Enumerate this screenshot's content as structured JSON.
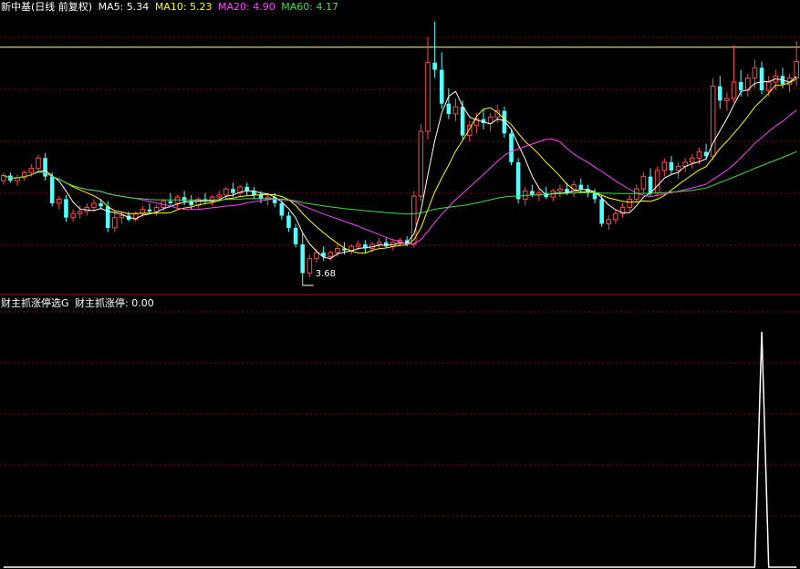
{
  "main_legend": {
    "name": "新中基(日线 前复权)",
    "ma5": "MA5: 5.34",
    "ma10": "MA10: 5.23",
    "ma20": "MA20: 4.90",
    "ma60": "MA60: 4.17"
  },
  "sub_legend": {
    "name": "财主抓涨停选G",
    "value": "财主抓涨停: 0.00"
  },
  "colors": {
    "background": "#000000",
    "grid": "#8b0000",
    "up": "#ff4a4a",
    "down": "#54ffff",
    "ma5": "#ffffff",
    "ma10": "#ffff00",
    "ma20": "#ff44ff",
    "ma60": "#44dd44",
    "hline": "#ffff88",
    "signal": "#ffffff"
  },
  "chart_data": [
    {
      "type": "candlestick",
      "title": "新中基(日线 前复权)",
      "y_range": [
        3.6,
        6.3
      ],
      "horizontal_line": 6.0,
      "low_marker": "3.68",
      "ohlc": [
        [
          4.7,
          4.78,
          4.66,
          4.75
        ],
        [
          4.75,
          4.78,
          4.68,
          4.7
        ],
        [
          4.7,
          4.76,
          4.65,
          4.73
        ],
        [
          4.73,
          4.8,
          4.7,
          4.78
        ],
        [
          4.78,
          4.86,
          4.74,
          4.82
        ],
        [
          4.82,
          4.95,
          4.8,
          4.92
        ],
        [
          4.92,
          4.97,
          4.7,
          4.74
        ],
        [
          4.74,
          4.78,
          4.45,
          4.48
        ],
        [
          4.48,
          4.55,
          4.42,
          4.52
        ],
        [
          4.52,
          4.56,
          4.3,
          4.34
        ],
        [
          4.34,
          4.42,
          4.3,
          4.38
        ],
        [
          4.38,
          4.46,
          4.33,
          4.4
        ],
        [
          4.4,
          4.48,
          4.36,
          4.44
        ],
        [
          4.44,
          4.52,
          4.4,
          4.48
        ],
        [
          4.48,
          4.52,
          4.42,
          4.45
        ],
        [
          4.45,
          4.5,
          4.2,
          4.24
        ],
        [
          4.24,
          4.4,
          4.2,
          4.34
        ],
        [
          4.34,
          4.4,
          4.28,
          4.36
        ],
        [
          4.36,
          4.4,
          4.3,
          4.32
        ],
        [
          4.32,
          4.4,
          4.3,
          4.38
        ],
        [
          4.38,
          4.45,
          4.35,
          4.42
        ],
        [
          4.42,
          4.48,
          4.38,
          4.4
        ],
        [
          4.4,
          4.46,
          4.36,
          4.44
        ],
        [
          4.44,
          4.52,
          4.4,
          4.5
        ],
        [
          4.5,
          4.58,
          4.46,
          4.48
        ],
        [
          4.48,
          4.56,
          4.44,
          4.54
        ],
        [
          4.54,
          4.6,
          4.46,
          4.5
        ],
        [
          4.5,
          4.56,
          4.42,
          4.46
        ],
        [
          4.46,
          4.54,
          4.42,
          4.52
        ],
        [
          4.52,
          4.58,
          4.48,
          4.5
        ],
        [
          4.5,
          4.56,
          4.46,
          4.54
        ],
        [
          4.54,
          4.6,
          4.5,
          4.56
        ],
        [
          4.56,
          4.64,
          4.52,
          4.62
        ],
        [
          4.62,
          4.68,
          4.54,
          4.58
        ],
        [
          4.58,
          4.66,
          4.54,
          4.64
        ],
        [
          4.64,
          4.68,
          4.56,
          4.6
        ],
        [
          4.6,
          4.64,
          4.52,
          4.56
        ],
        [
          4.56,
          4.6,
          4.48,
          4.52
        ],
        [
          4.52,
          4.58,
          4.46,
          4.54
        ],
        [
          4.54,
          4.58,
          4.44,
          4.48
        ],
        [
          4.48,
          4.52,
          4.32,
          4.36
        ],
        [
          4.36,
          4.4,
          4.2,
          4.24
        ],
        [
          4.24,
          4.28,
          4.05,
          4.08
        ],
        [
          4.08,
          4.18,
          3.68,
          3.8
        ],
        [
          3.8,
          3.98,
          3.76,
          3.94
        ],
        [
          3.94,
          4.04,
          3.9,
          4.0
        ],
        [
          4.0,
          4.06,
          3.92,
          3.96
        ],
        [
          3.96,
          4.02,
          3.92,
          4.0
        ],
        [
          4.0,
          4.08,
          3.96,
          4.04
        ],
        [
          4.04,
          4.1,
          3.98,
          4.02
        ],
        [
          4.02,
          4.08,
          3.98,
          4.06
        ],
        [
          4.06,
          4.12,
          4.02,
          4.08
        ],
        [
          4.08,
          4.12,
          4.0,
          4.04
        ],
        [
          4.04,
          4.1,
          4.0,
          4.08
        ],
        [
          4.08,
          4.14,
          4.04,
          4.1
        ],
        [
          4.1,
          4.14,
          4.04,
          4.06
        ],
        [
          4.06,
          4.12,
          4.02,
          4.1
        ],
        [
          4.1,
          4.14,
          4.06,
          4.12
        ],
        [
          4.12,
          4.16,
          4.06,
          4.08
        ],
        [
          4.08,
          4.6,
          4.05,
          4.55
        ],
        [
          4.55,
          5.25,
          4.5,
          5.18
        ],
        [
          5.18,
          6.1,
          5.1,
          5.85
        ],
        [
          5.85,
          6.25,
          5.7,
          5.78
        ],
        [
          5.78,
          5.95,
          5.4,
          5.45
        ],
        [
          5.45,
          5.6,
          5.3,
          5.35
        ],
        [
          5.35,
          5.5,
          5.28,
          5.42
        ],
        [
          5.42,
          5.48,
          5.1,
          5.14
        ],
        [
          5.14,
          5.28,
          5.08,
          5.24
        ],
        [
          5.24,
          5.36,
          5.16,
          5.3
        ],
        [
          5.3,
          5.4,
          5.2,
          5.26
        ],
        [
          5.26,
          5.36,
          5.18,
          5.32
        ],
        [
          5.32,
          5.44,
          5.26,
          5.38
        ],
        [
          5.38,
          5.42,
          5.12,
          5.16
        ],
        [
          5.16,
          5.2,
          4.85,
          4.88
        ],
        [
          4.88,
          4.92,
          4.48,
          4.52
        ],
        [
          4.52,
          4.64,
          4.46,
          4.6
        ],
        [
          4.6,
          4.66,
          4.54,
          4.56
        ],
        [
          4.56,
          4.62,
          4.5,
          4.58
        ],
        [
          4.58,
          4.64,
          4.52,
          4.54
        ],
        [
          4.54,
          4.62,
          4.5,
          4.6
        ],
        [
          4.6,
          4.66,
          4.54,
          4.62
        ],
        [
          4.62,
          4.68,
          4.56,
          4.58
        ],
        [
          4.58,
          4.7,
          4.54,
          4.66
        ],
        [
          4.66,
          4.72,
          4.58,
          4.62
        ],
        [
          4.62,
          4.66,
          4.54,
          4.58
        ],
        [
          4.58,
          4.62,
          4.48,
          4.52
        ],
        [
          4.52,
          4.56,
          4.25,
          4.28
        ],
        [
          4.28,
          4.36,
          4.22,
          4.32
        ],
        [
          4.32,
          4.42,
          4.28,
          4.38
        ],
        [
          4.38,
          4.48,
          4.34,
          4.44
        ],
        [
          4.44,
          4.56,
          4.4,
          4.52
        ],
        [
          4.52,
          4.66,
          4.48,
          4.62
        ],
        [
          4.62,
          4.78,
          4.58,
          4.74
        ],
        [
          4.74,
          4.82,
          4.55,
          4.58
        ],
        [
          4.58,
          4.84,
          4.55,
          4.8
        ],
        [
          4.8,
          4.92,
          4.74,
          4.88
        ],
        [
          4.88,
          4.94,
          4.76,
          4.8
        ],
        [
          4.8,
          4.88,
          4.72,
          4.84
        ],
        [
          4.84,
          4.92,
          4.78,
          4.88
        ],
        [
          4.88,
          4.96,
          4.82,
          4.92
        ],
        [
          4.92,
          5.02,
          4.86,
          4.98
        ],
        [
          4.98,
          5.06,
          4.9,
          4.94
        ],
        [
          4.94,
          5.7,
          4.9,
          5.62
        ],
        [
          5.62,
          5.72,
          5.4,
          5.48
        ],
        [
          5.48,
          5.56,
          5.38,
          5.5
        ],
        [
          5.5,
          6.02,
          5.46,
          5.66
        ],
        [
          5.66,
          5.78,
          5.52,
          5.58
        ],
        [
          5.58,
          5.74,
          5.52,
          5.7
        ],
        [
          5.7,
          5.88,
          5.6,
          5.8
        ],
        [
          5.8,
          5.86,
          5.54,
          5.58
        ],
        [
          5.58,
          5.72,
          5.52,
          5.66
        ],
        [
          5.66,
          5.78,
          5.58,
          5.72
        ],
        [
          5.72,
          5.8,
          5.6,
          5.64
        ],
        [
          5.64,
          5.74,
          5.56,
          5.7
        ],
        [
          5.7,
          6.06,
          5.62,
          5.86
        ]
      ]
    },
    {
      "type": "line",
      "title": "财主抓涨停选G",
      "y_range": [
        0,
        1.1
      ],
      "spike_index": 109,
      "spike_value": 1
    }
  ]
}
